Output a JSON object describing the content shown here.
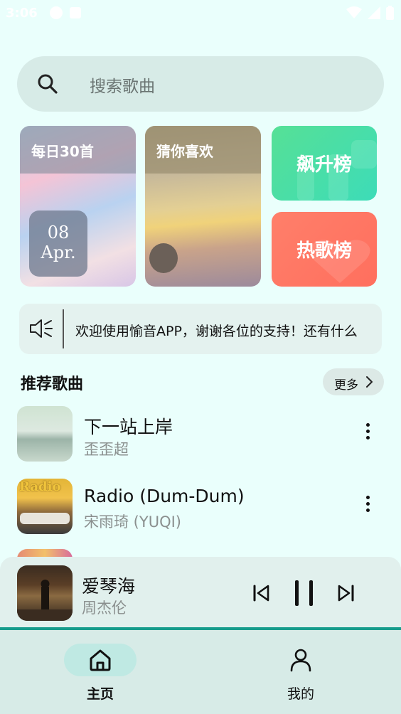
{
  "status_bar": {
    "time": "3:06"
  },
  "search": {
    "placeholder": "搜索歌曲"
  },
  "cards": {
    "daily": {
      "title": "每日30首",
      "day": "08",
      "month": "Apr."
    },
    "guess": {
      "title": "猜你喜欢"
    },
    "rise": {
      "title": "飙升榜"
    },
    "hot": {
      "title": "热歌榜"
    }
  },
  "notice": {
    "text": "欢迎使用愉音APP，谢谢各位的支持！还有什么"
  },
  "recommended": {
    "title": "推荐歌曲",
    "more_label": "更多",
    "songs": [
      {
        "title": "下一站上岸",
        "artist": "歪歪超"
      },
      {
        "title": "Radio (Dum-Dum)",
        "artist": "宋雨琦 (YUQI)",
        "cover_text": "Radio"
      }
    ]
  },
  "player": {
    "title": "爱琴海",
    "artist": "周杰伦",
    "progress": 1.0,
    "accent": "#169c8c"
  },
  "tabs": [
    {
      "label": "主页",
      "icon": "home-icon",
      "active": true
    },
    {
      "label": "我的",
      "icon": "user-icon",
      "active": false
    }
  ],
  "colors": {
    "background": "#eafffc",
    "accent": "#169c8c",
    "rise_card": "#3ddcb8",
    "hot_card": "#ff6f5e"
  }
}
